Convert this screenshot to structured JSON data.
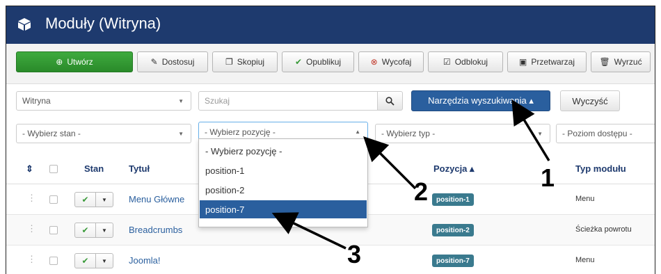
{
  "header": {
    "title": "Moduły (Witryna)"
  },
  "toolbar": {
    "new": "Utwórz",
    "edit": "Dostosuj",
    "copy": "Skopiuj",
    "publish": "Opublikuj",
    "unpublish": "Wycofaj",
    "checkin": "Odblokuj",
    "batch": "Przetwarzaj",
    "trash": "Wyrzuć"
  },
  "filters": {
    "client": "Witryna",
    "search_placeholder": "Szukaj",
    "search_tools": "Narzędzia wyszukiwania ▴",
    "clear": "Wyczyść",
    "state": "- Wybierz stan -",
    "position": "- Wybierz pozycję -",
    "type": "- Wybierz typ -",
    "access": "- Poziom dostępu -"
  },
  "position_options": [
    "- Wybierz pozycję -",
    "position-1",
    "position-2",
    "position-7"
  ],
  "table": {
    "headers": {
      "order": "⇕",
      "state": "Stan",
      "title": "Tytuł",
      "position": "Pozycja ▴",
      "type": "Typ modułu"
    },
    "rows": [
      {
        "title": "Menu Główne",
        "position": "position-1",
        "type": "Menu"
      },
      {
        "title": "Breadcrumbs",
        "position": "position-2",
        "type": "Ścieżka powrotu"
      },
      {
        "title": "Joomla!",
        "position": "position-7",
        "type": "Menu"
      }
    ]
  },
  "annotations": [
    "1",
    "2",
    "3"
  ],
  "colors": {
    "header": "#1e3a6e",
    "primary": "#2a5f9e",
    "success": "#2a8a2a",
    "badge": "#3a7a8e"
  }
}
